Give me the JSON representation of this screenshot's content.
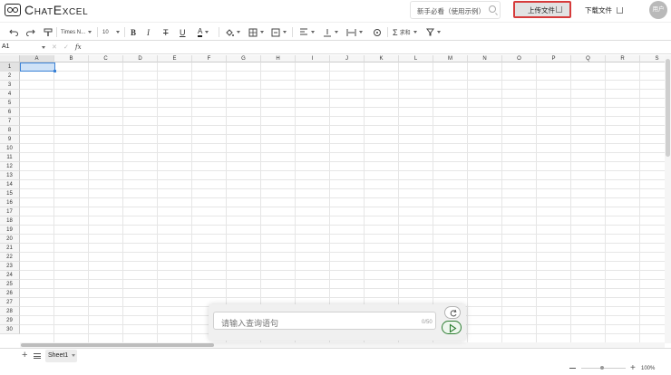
{
  "header": {
    "app_name": "ChatExcel",
    "search_text": "新手必看（使用示例）",
    "upload_label": "上传文件",
    "download_label": "下载文件",
    "user_label": "用户"
  },
  "toolbar": {
    "font_name": "Times N...",
    "font_size": "10",
    "sum_label": "求和",
    "icons": [
      "undo-icon",
      "redo-icon",
      "format-painter-icon",
      "bold-icon",
      "italic-icon",
      "strikethrough-icon",
      "underline-icon",
      "text-color-icon",
      "fill-color-icon",
      "border-icon",
      "merge-icon",
      "align-icon",
      "valign-icon",
      "wrap-icon",
      "rotate-icon",
      "sum-icon",
      "filter-icon"
    ],
    "accent_color": "#d63b3b"
  },
  "formula_bar": {
    "cell_ref": "A1",
    "fx_label": "fx"
  },
  "grid": {
    "columns": [
      "A",
      "B",
      "C",
      "D",
      "E",
      "F",
      "G",
      "H",
      "I",
      "J",
      "K",
      "L",
      "M",
      "N",
      "O",
      "P",
      "Q",
      "R",
      "S"
    ],
    "rows": [
      "1",
      "2",
      "3",
      "4",
      "5",
      "6",
      "7",
      "8",
      "9",
      "10",
      "11",
      "12",
      "13",
      "14",
      "15",
      "16",
      "17",
      "18",
      "19",
      "20",
      "21",
      "22",
      "23",
      "24",
      "25",
      "26",
      "27",
      "28",
      "29",
      "30"
    ],
    "selected_cell": "A1",
    "selection_color": "#3b82d6"
  },
  "query": {
    "placeholder": "请输入查询语句",
    "counter": "0/50"
  },
  "sheetbar": {
    "tab_label": "Sheet1"
  },
  "statusbar": {
    "zoom": "100%"
  }
}
